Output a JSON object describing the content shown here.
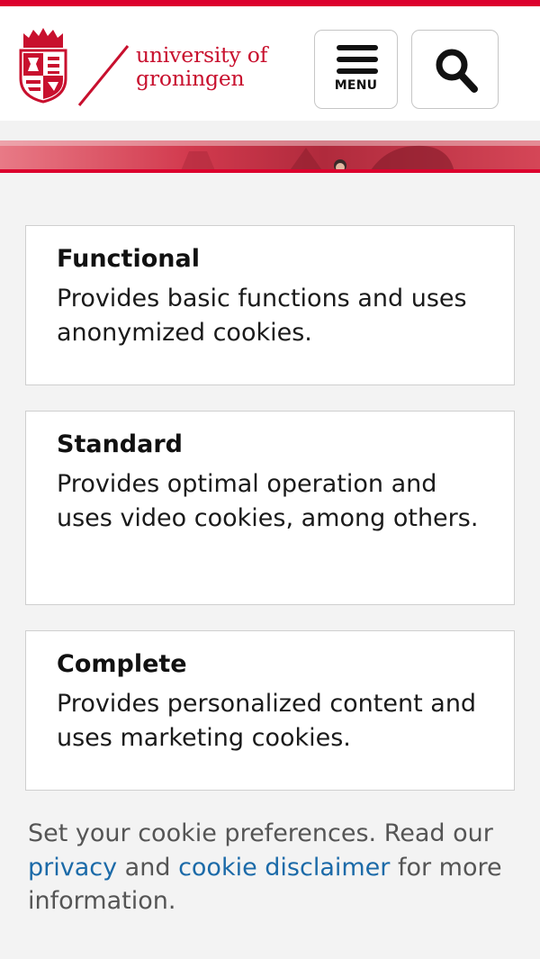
{
  "header": {
    "logo_line1": "university of",
    "logo_line2": "groningen",
    "menu_label": "MENU",
    "brand_color": "#dc002d",
    "menu_icon": "hamburger-icon",
    "search_icon": "search-icon"
  },
  "options": [
    {
      "title": "Functional",
      "description": "Provides basic functions and uses anonymized cookies."
    },
    {
      "title": "Standard",
      "description": "Provides optimal operation and uses video cookies, among others."
    },
    {
      "title": "Complete",
      "description": "Provides personalized content and uses marketing cookies."
    }
  ],
  "footer": {
    "text_before": "Set your cookie preferences. Read our ",
    "privacy_link": "privacy",
    "text_and": " and ",
    "disclaimer_link": "cookie disclaimer",
    "text_after": " for more information.",
    "link_color": "#1b6aa8"
  }
}
